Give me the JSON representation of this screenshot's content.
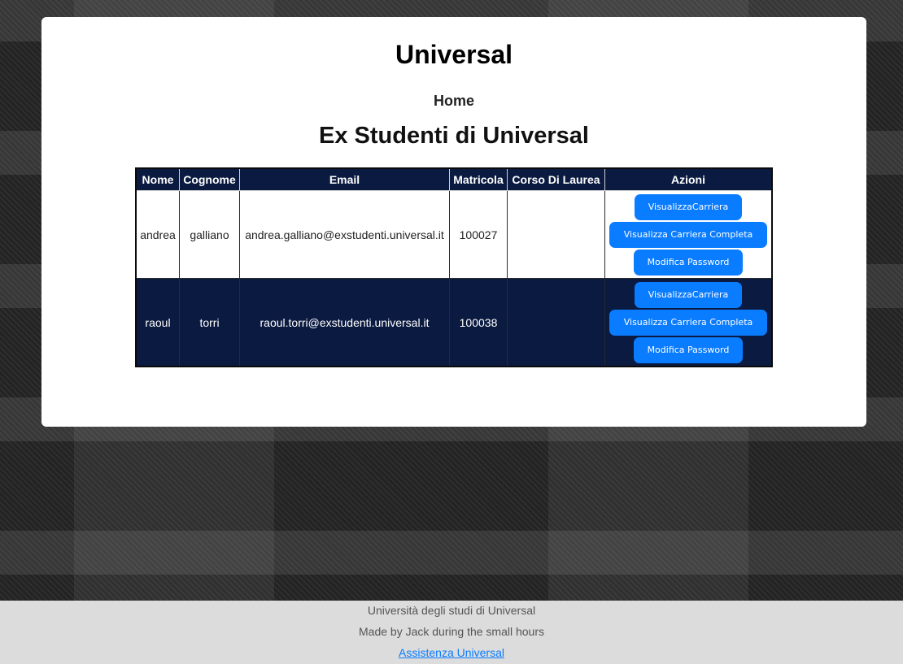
{
  "site": {
    "title": "Universal"
  },
  "nav": {
    "home_label": "Home"
  },
  "page": {
    "title": "Ex Studenti di Universal"
  },
  "table": {
    "headers": [
      "Nome",
      "Cognome",
      "Email",
      "Matricola",
      "Corso Di Laurea",
      "Azioni"
    ],
    "rows": [
      {
        "nome": "andrea",
        "cognome": "galliano",
        "email": "andrea.galliano@exstudenti.universal.it",
        "matricola": "100027",
        "corso": "",
        "actions": [
          "VisualizzaCarriera",
          "Visualizza Carriera Completa",
          "Modifica Password"
        ]
      },
      {
        "nome": "raoul",
        "cognome": "torri",
        "email": "raoul.torri@exstudenti.universal.it",
        "matricola": "100038",
        "corso": "",
        "actions": [
          "VisualizzaCarriera",
          "Visualizza Carriera Completa",
          "Modifica Password"
        ]
      }
    ]
  },
  "footer": {
    "university": "Università degli studi di Universal",
    "credit": "Made by Jack during the small hours",
    "support_link": "Assistenza Universal"
  },
  "colors": {
    "header_bg": "#0b1a40",
    "button_bg": "#0a7cff",
    "footer_bg": "#dcdcdc"
  }
}
